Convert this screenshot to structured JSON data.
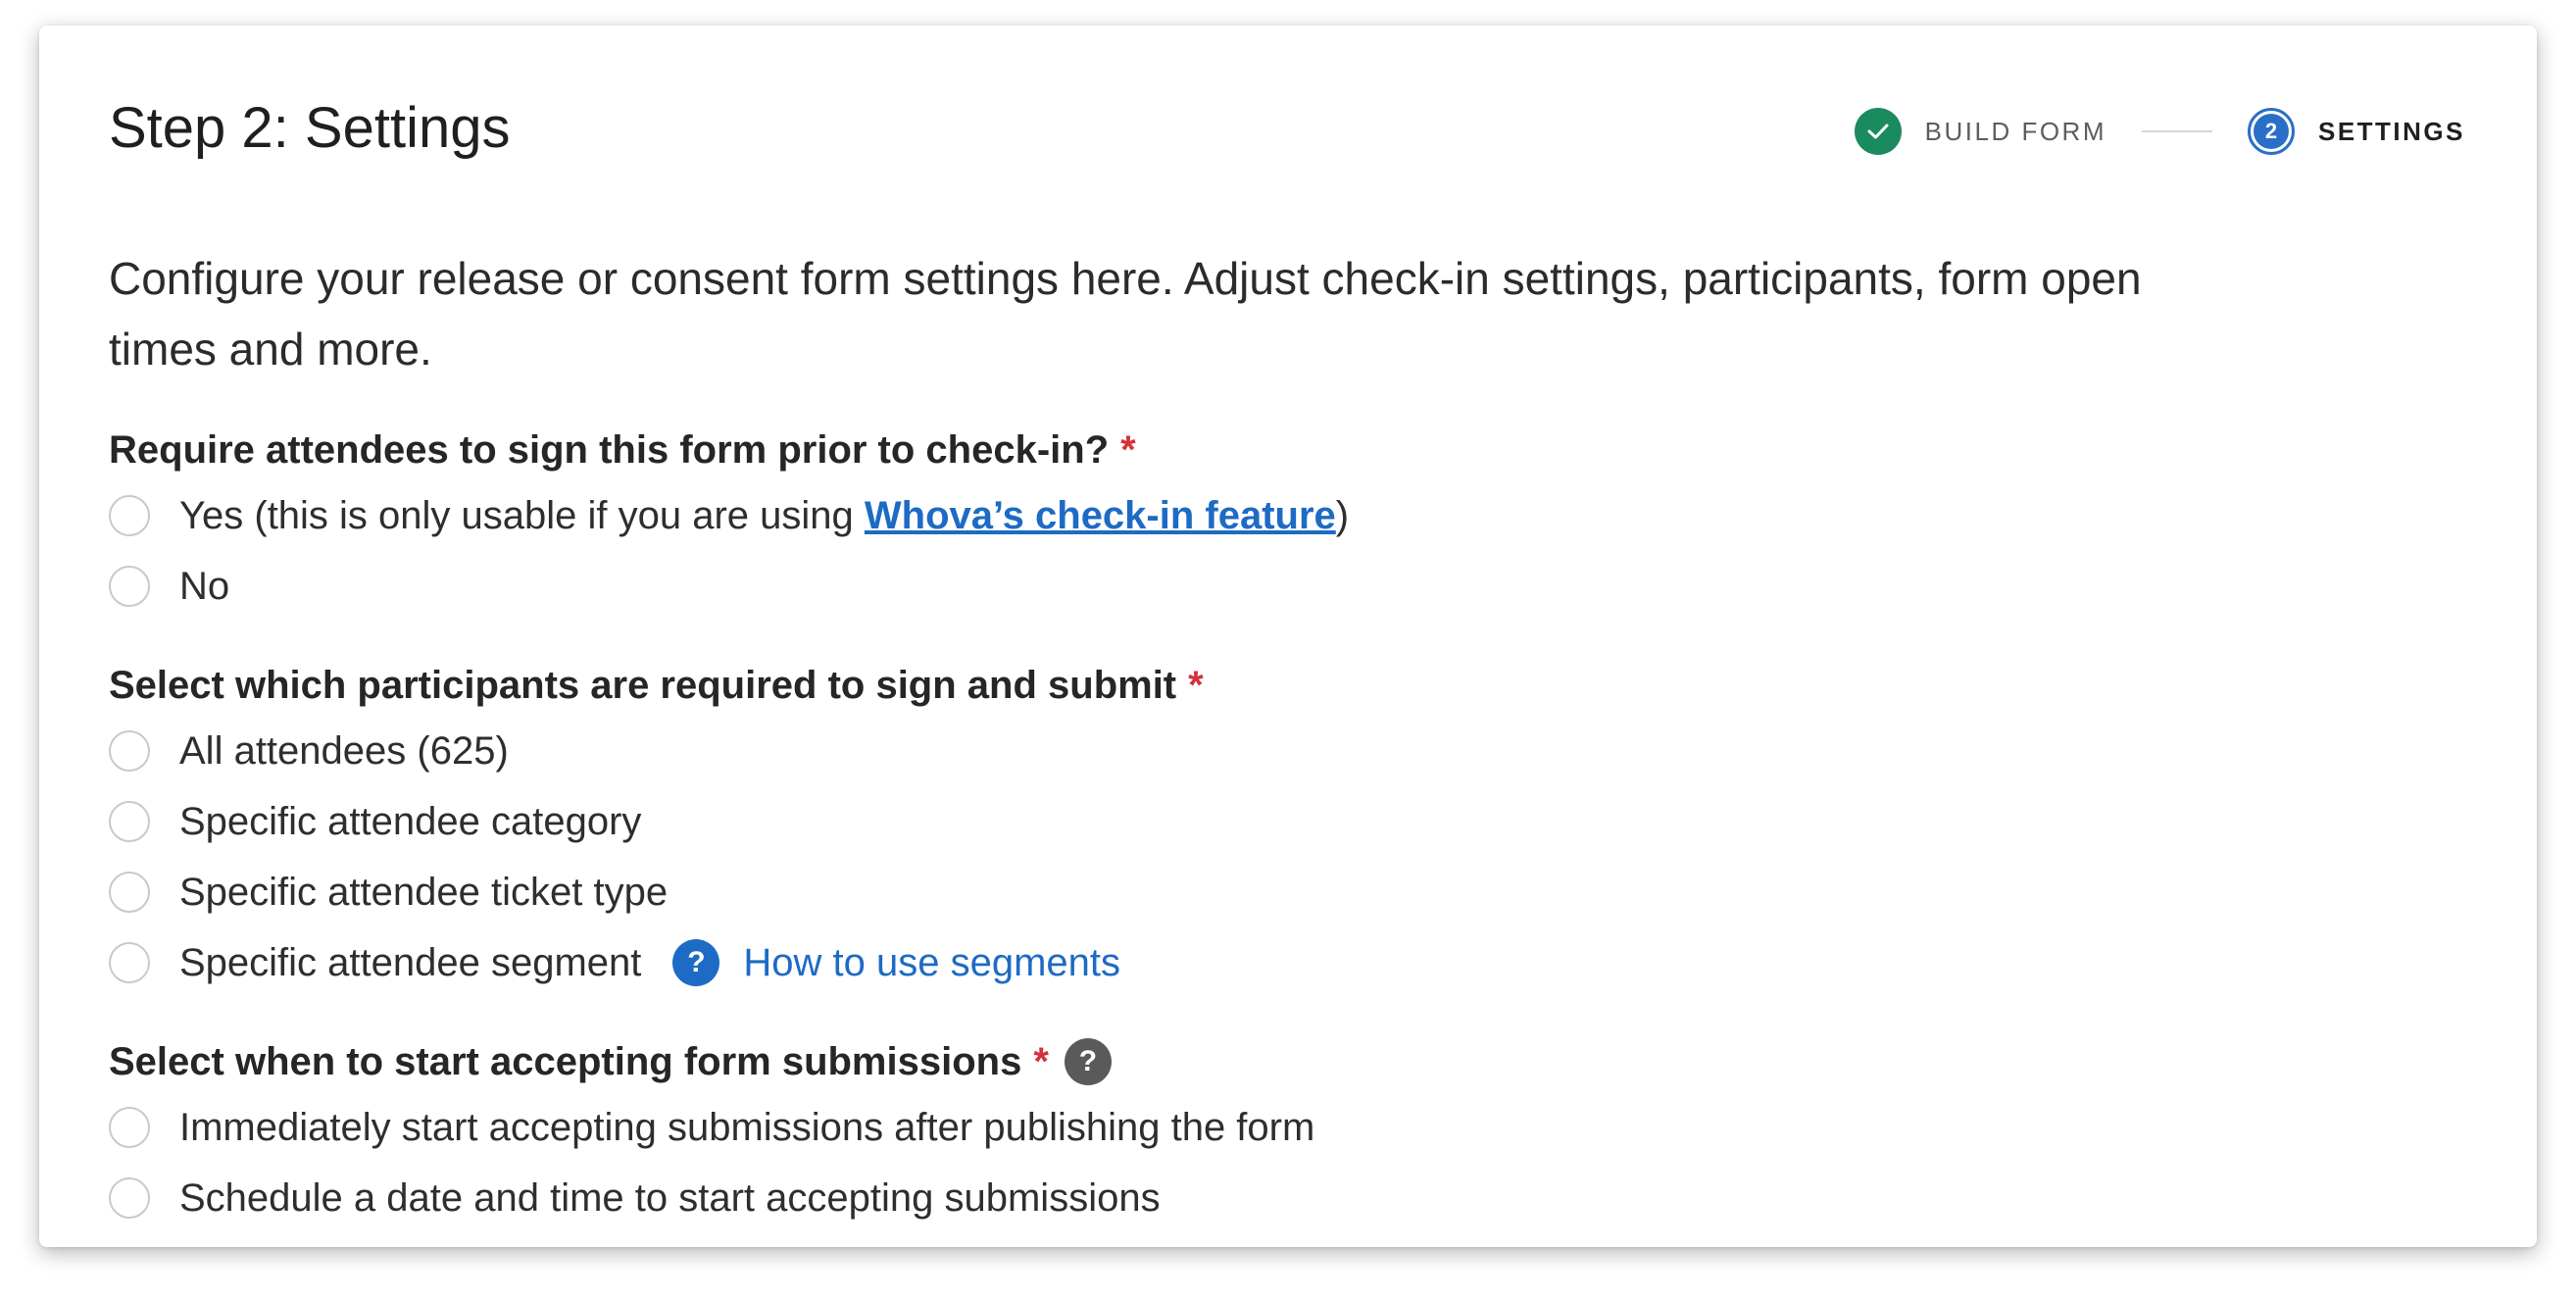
{
  "header": {
    "title": "Step 2: Settings"
  },
  "stepper": {
    "steps": [
      {
        "label": "BUILD FORM",
        "state": "completed"
      },
      {
        "label": "SETTINGS",
        "number": "2",
        "state": "current"
      }
    ]
  },
  "description": "Configure your release or consent form settings here. Adjust check-in settings, participants, form open times and more.",
  "sections": {
    "checkin": {
      "question": "Require attendees to sign this form prior to check-in?",
      "required_mark": "*",
      "options": {
        "yes_prefix": "Yes (this is only usable if you are using ",
        "yes_link": "Whova’s check-in feature",
        "yes_suffix": ")",
        "no": "No"
      }
    },
    "participants": {
      "question": "Select which participants are required to sign and submit",
      "required_mark": "*",
      "options": {
        "all": "All attendees (625)",
        "category": "Specific attendee category",
        "ticket": "Specific attendee ticket type",
        "segment": "Specific attendee segment"
      },
      "help_icon_glyph": "?",
      "help_link": "How to use segments"
    },
    "start": {
      "question": "Select when to start accepting form submissions",
      "required_mark": "*",
      "help_icon_glyph": "?",
      "options": {
        "immediately": "Immediately start accepting submissions after publishing the form",
        "schedule": "Schedule a date and time to start accepting submissions"
      }
    }
  },
  "colors": {
    "accent_blue": "#1d6bc4",
    "step_done_green": "#1a8a5f",
    "required_red": "#d1333b"
  },
  "icons": {
    "step_done": "check-icon",
    "help": "question-mark-icon"
  }
}
